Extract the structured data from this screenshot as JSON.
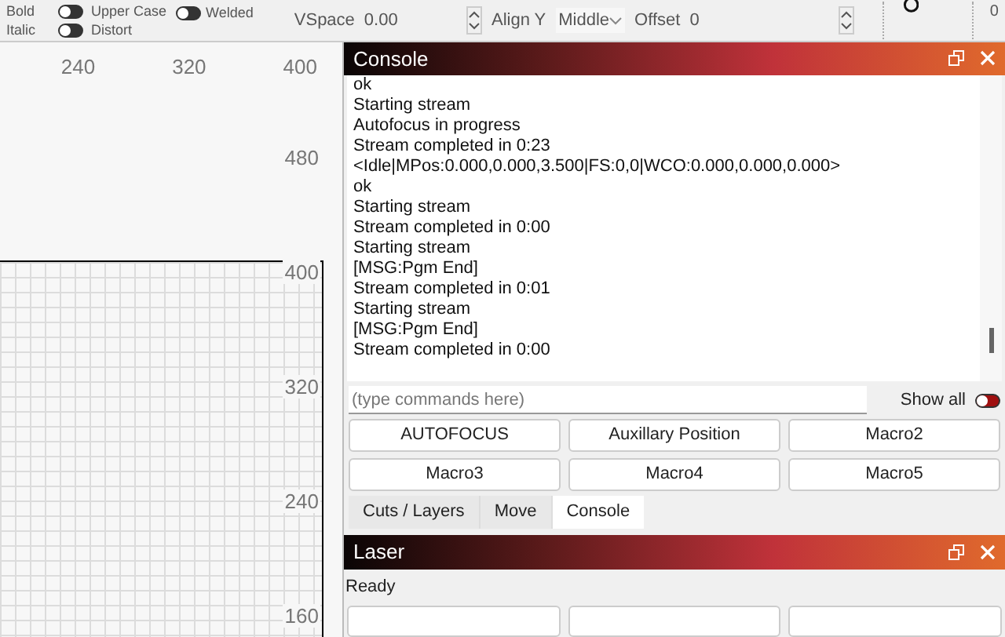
{
  "toolbar": {
    "toggles": [
      {
        "style": "Bold",
        "label": "Upper Case",
        "on": false
      },
      {
        "style": "Italic",
        "label": "Distort",
        "on": false
      }
    ],
    "welded": {
      "label": "Welded",
      "on": false
    },
    "vspace": {
      "label": "VSpace",
      "value": "0.00"
    },
    "align_y": {
      "label": "Align Y",
      "value": "Middle"
    },
    "offset": {
      "label": "Offset",
      "value": "0"
    },
    "extra_value": "0"
  },
  "canvas": {
    "top_ruler": [
      "240",
      "320",
      "400"
    ],
    "side_ruler": [
      "480",
      "400",
      "320",
      "240",
      "160"
    ]
  },
  "console": {
    "title": "Console",
    "lines": [
      "ok",
      "Starting stream",
      "Autofocus in progress",
      "Stream completed in 0:23",
      "<Idle|MPos:0.000,0.000,3.500|FS:0,0|WCO:0.000,0.000,0.000>",
      "ok",
      "Starting stream",
      "Stream completed in 0:00",
      "Starting stream",
      "[MSG:Pgm End]",
      "Stream completed in 0:01",
      "Starting stream",
      "[MSG:Pgm End]",
      "Stream completed in 0:00"
    ],
    "command": {
      "placeholder": "(type commands here)"
    },
    "show_all": {
      "label": "Show all",
      "on": false
    },
    "macros": [
      "AUTOFOCUS",
      "Auxillary Position",
      "Macro2",
      "Macro3",
      "Macro4",
      "Macro5"
    ]
  },
  "tabs": [
    {
      "label": "Cuts / Layers",
      "selected": false
    },
    {
      "label": "Move",
      "selected": false
    },
    {
      "label": "Console",
      "selected": true
    }
  ],
  "laser": {
    "title": "Laser",
    "status": "Ready"
  }
}
